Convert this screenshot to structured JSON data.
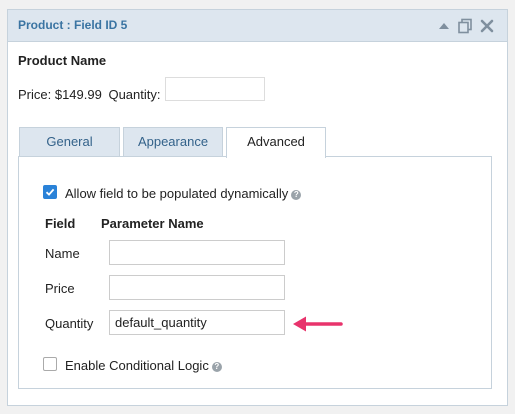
{
  "panel": {
    "title": "Product : Field ID 5",
    "icons": [
      "collapse-icon",
      "duplicate-icon",
      "delete-icon"
    ]
  },
  "field": {
    "name": "Product Name",
    "price_text": "Price: $149.99",
    "quantity_label": "Quantity:"
  },
  "tabs": [
    {
      "label": "General",
      "active": false
    },
    {
      "label": "Appearance",
      "active": false
    },
    {
      "label": "Advanced",
      "active": true
    }
  ],
  "advanced": {
    "dynamic_checkbox_label": "Allow field to be populated dynamically",
    "dynamic_checked": true,
    "col_field": "Field",
    "col_param": "Parameter Name",
    "rows": [
      {
        "label": "Name",
        "value": ""
      },
      {
        "label": "Price",
        "value": ""
      },
      {
        "label": "Quantity",
        "value": "default_quantity"
      }
    ],
    "conditional_label": "Enable Conditional Logic",
    "conditional_checked": false
  },
  "colors": {
    "accent": "#2a82d8",
    "header_bg": "#dde6ef",
    "title": "#3a74a2",
    "arrow": "#e8336c"
  }
}
